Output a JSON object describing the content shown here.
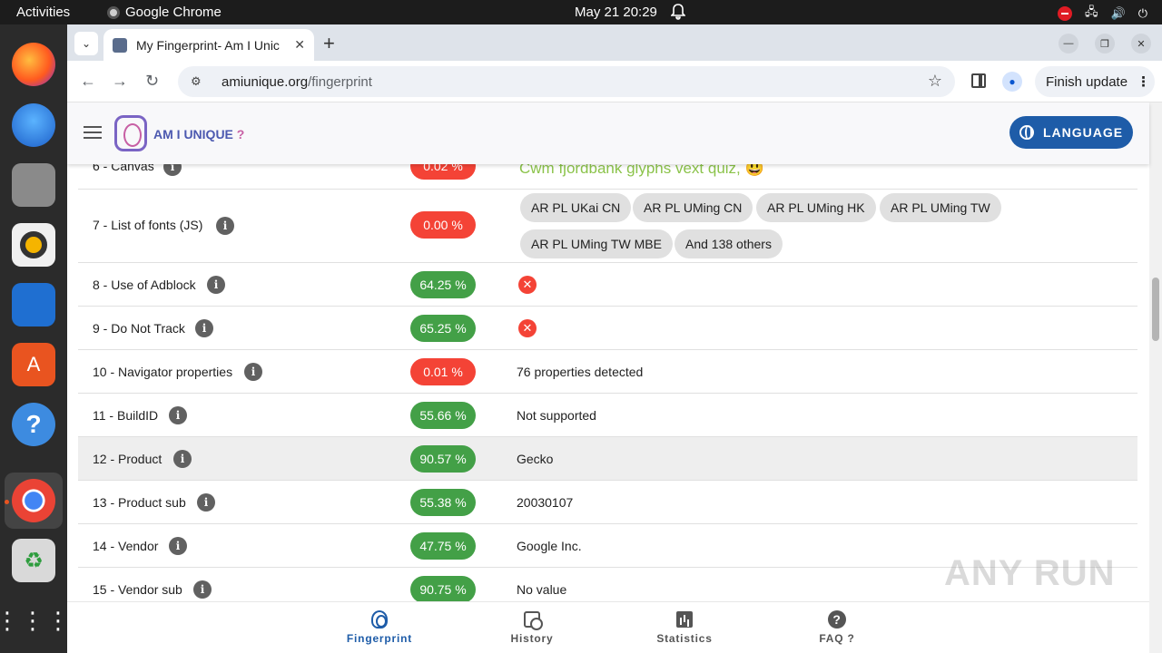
{
  "os": {
    "activities": "Activities",
    "app_name": "Google Chrome",
    "clock": "May 21  20:29"
  },
  "browser": {
    "tab_title": "My Fingerprint- Am I Unic",
    "url_host": "amiunique.org",
    "url_path": "/fingerprint",
    "finish_update": "Finish update"
  },
  "site": {
    "logo_text": "AM I UNIQUE",
    "logo_q": "?",
    "language_btn": "LANGUAGE"
  },
  "rows": [
    {
      "name": "6 - Canvas",
      "pct": "0.02 %",
      "status": "red",
      "value_text": "Cwm fjordbank glyphs vext quiz, 😃"
    },
    {
      "name": "7 - List of fonts (JS)",
      "pct": "0.00 %",
      "status": "red",
      "chips": [
        "AR PL UKai CN",
        "AR PL UMing CN",
        "AR PL UMing HK",
        "AR PL UMing TW",
        "AR PL UMing TW MBE",
        "And 138 others"
      ]
    },
    {
      "name": "8 - Use of Adblock",
      "pct": "64.25 %",
      "status": "green",
      "value_icon": "x-icon"
    },
    {
      "name": "9 - Do Not Track",
      "pct": "65.25 %",
      "status": "green",
      "value_icon": "x-icon"
    },
    {
      "name": "10 - Navigator properties",
      "pct": "0.01 %",
      "status": "red",
      "value": "76 properties detected"
    },
    {
      "name": "11 - BuildID",
      "pct": "55.66 %",
      "status": "green",
      "value": "Not supported"
    },
    {
      "name": "12 - Product",
      "pct": "90.57 %",
      "status": "green",
      "value": "Gecko"
    },
    {
      "name": "13 - Product sub",
      "pct": "55.38 %",
      "status": "green",
      "value": "20030107"
    },
    {
      "name": "14 - Vendor",
      "pct": "47.75 %",
      "status": "green",
      "value": "Google Inc."
    },
    {
      "name": "15 - Vendor sub",
      "pct": "90.75 %",
      "status": "green",
      "value": "No value"
    }
  ],
  "bottom_nav": [
    {
      "label": "Fingerprint",
      "icon": "fingerprint-icon"
    },
    {
      "label": "History",
      "icon": "history-icon"
    },
    {
      "label": "Statistics",
      "icon": "statistics-icon"
    },
    {
      "label": "FAQ ?",
      "icon": "faq-icon"
    }
  ],
  "watermark": "ANY RUN"
}
